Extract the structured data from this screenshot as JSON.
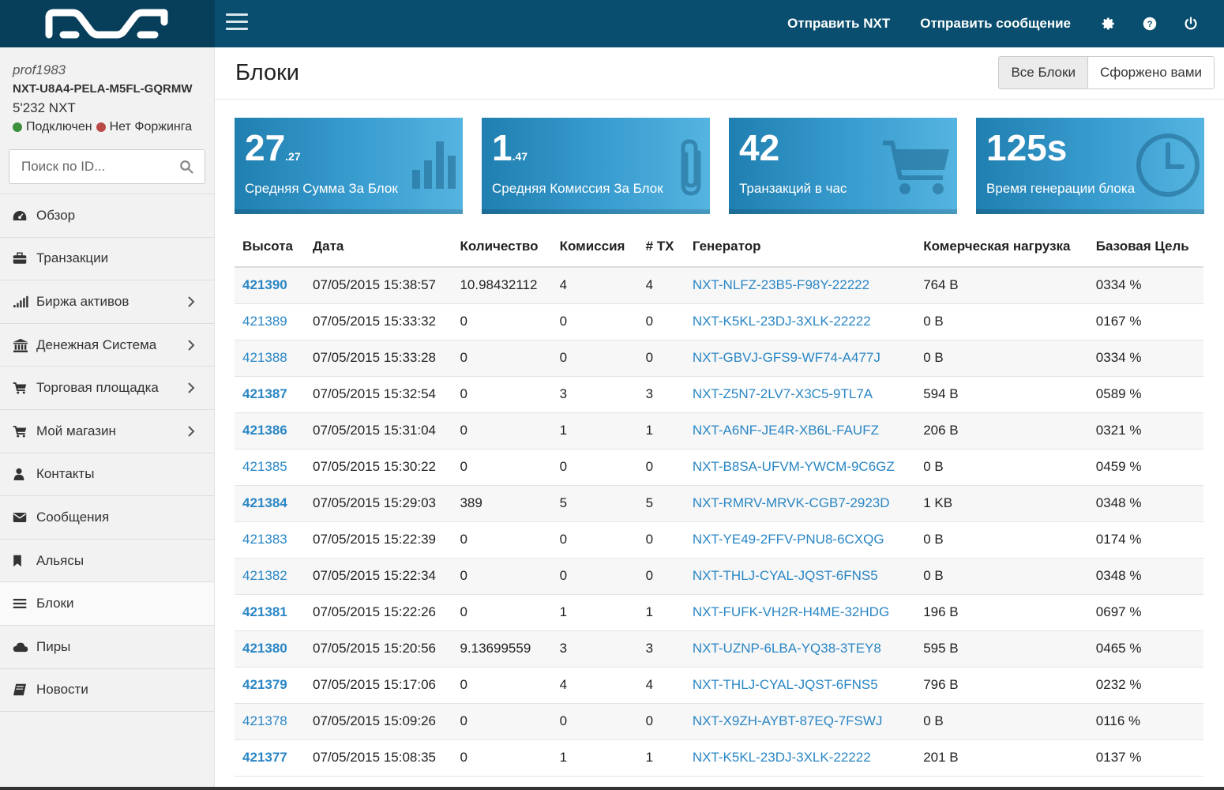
{
  "topbar": {
    "send_nxt": "Отправить NXT",
    "send_message": "Отправить сообщение",
    "icons": [
      "gear-icon",
      "question-icon",
      "power-icon"
    ]
  },
  "account": {
    "username": "prof1983",
    "account_id": "NXT-U8A4-PELA-M5FL-GQRMW",
    "balance": "5'232 NXT",
    "connected": "Подключен",
    "forging": "Нет Форжинга"
  },
  "search": {
    "placeholder": "Поиск по ID..."
  },
  "menu": [
    {
      "label": "Обзор",
      "icon": "dashboard-icon",
      "has_submenu": false
    },
    {
      "label": "Транзакции",
      "icon": "briefcase-icon",
      "has_submenu": false
    },
    {
      "label": "Биржа активов",
      "icon": "signal-icon",
      "has_submenu": true
    },
    {
      "label": "Денежная Система",
      "icon": "bank-icon",
      "has_submenu": true
    },
    {
      "label": "Торговая площадка",
      "icon": "cart-icon",
      "has_submenu": true
    },
    {
      "label": "Мой магазин",
      "icon": "cart-icon",
      "has_submenu": true
    },
    {
      "label": "Контакты",
      "icon": "user-icon",
      "has_submenu": false
    },
    {
      "label": "Сообщения",
      "icon": "envelope-icon",
      "has_submenu": false
    },
    {
      "label": "Альясы",
      "icon": "bookmark-icon",
      "has_submenu": false
    },
    {
      "label": "Блоки",
      "icon": "list-icon",
      "has_submenu": false,
      "active": true
    },
    {
      "label": "Пиры",
      "icon": "cloud-icon",
      "has_submenu": false
    },
    {
      "label": "Новости",
      "icon": "book-icon",
      "has_submenu": false
    }
  ],
  "page": {
    "title": "Блоки",
    "filter_all": "Все Блоки",
    "filter_forged": "Сфорженo вами"
  },
  "stats": [
    {
      "big": "27",
      "small": ".27",
      "label": "Средняя Сумма За Блок",
      "icon": "bar-chart-icon"
    },
    {
      "big": "1",
      "small": ".47",
      "label": "Средняя Комиссия За Блок",
      "icon": "paperclip-icon"
    },
    {
      "big": "42",
      "small": "",
      "label": "Транзакций в час",
      "icon": "cart-icon"
    },
    {
      "big": "125s",
      "small": "",
      "label": "Время генерации блока",
      "icon": "clock-icon"
    }
  ],
  "table": {
    "headers": [
      "Высота",
      "Дата",
      "Количество",
      "Комиссия",
      "# TX",
      "Генератор",
      "Комерческая нагрузка",
      "Базовая Цель"
    ],
    "rows": [
      {
        "height": "421390",
        "bold": true,
        "date": "07/05/2015 15:38:57",
        "amount": "10.98432112",
        "fee": "4",
        "tx": "4",
        "generator": "NXT-NLFZ-23B5-F98Y-22222",
        "payload": "764 B",
        "target": "0334 %"
      },
      {
        "height": "421389",
        "bold": false,
        "date": "07/05/2015 15:33:32",
        "amount": "0",
        "fee": "0",
        "tx": "0",
        "generator": "NXT-K5KL-23DJ-3XLK-22222",
        "payload": "0 B",
        "target": "0167 %"
      },
      {
        "height": "421388",
        "bold": false,
        "date": "07/05/2015 15:33:28",
        "amount": "0",
        "fee": "0",
        "tx": "0",
        "generator": "NXT-GBVJ-GFS9-WF74-A477J",
        "payload": "0 B",
        "target": "0334 %"
      },
      {
        "height": "421387",
        "bold": true,
        "date": "07/05/2015 15:32:54",
        "amount": "0",
        "fee": "3",
        "tx": "3",
        "generator": "NXT-Z5N7-2LV7-X3C5-9TL7A",
        "payload": "594 B",
        "target": "0589 %"
      },
      {
        "height": "421386",
        "bold": true,
        "date": "07/05/2015 15:31:04",
        "amount": "0",
        "fee": "1",
        "tx": "1",
        "generator": "NXT-A6NF-JE4R-XB6L-FAUFZ",
        "payload": "206 B",
        "target": "0321 %"
      },
      {
        "height": "421385",
        "bold": false,
        "date": "07/05/2015 15:30:22",
        "amount": "0",
        "fee": "0",
        "tx": "0",
        "generator": "NXT-B8SA-UFVM-YWCM-9C6GZ",
        "payload": "0 B",
        "target": "0459 %"
      },
      {
        "height": "421384",
        "bold": true,
        "date": "07/05/2015 15:29:03",
        "amount": "389",
        "fee": "5",
        "tx": "5",
        "generator": "NXT-RMRV-MRVK-CGB7-2923D",
        "payload": "1 KB",
        "target": "0348 %"
      },
      {
        "height": "421383",
        "bold": false,
        "date": "07/05/2015 15:22:39",
        "amount": "0",
        "fee": "0",
        "tx": "0",
        "generator": "NXT-YE49-2FFV-PNU8-6CXQG",
        "payload": "0 B",
        "target": "0174 %"
      },
      {
        "height": "421382",
        "bold": false,
        "date": "07/05/2015 15:22:34",
        "amount": "0",
        "fee": "0",
        "tx": "0",
        "generator": "NXT-THLJ-CYAL-JQST-6FNS5",
        "payload": "0 B",
        "target": "0348 %"
      },
      {
        "height": "421381",
        "bold": true,
        "date": "07/05/2015 15:22:26",
        "amount": "0",
        "fee": "1",
        "tx": "1",
        "generator": "NXT-FUFK-VH2R-H4ME-32HDG",
        "payload": "196 B",
        "target": "0697 %"
      },
      {
        "height": "421380",
        "bold": true,
        "date": "07/05/2015 15:20:56",
        "amount": "9.13699559",
        "fee": "3",
        "tx": "3",
        "generator": "NXT-UZNP-6LBA-YQ38-3TEY8",
        "payload": "595 B",
        "target": "0465 %"
      },
      {
        "height": "421379",
        "bold": true,
        "date": "07/05/2015 15:17:06",
        "amount": "0",
        "fee": "4",
        "tx": "4",
        "generator": "NXT-THLJ-CYAL-JQST-6FNS5",
        "payload": "796 B",
        "target": "0232 %"
      },
      {
        "height": "421378",
        "bold": false,
        "date": "07/05/2015 15:09:26",
        "amount": "0",
        "fee": "0",
        "tx": "0",
        "generator": "NXT-X9ZH-AYBT-87EQ-7FSWJ",
        "payload": "0 B",
        "target": "0116 %"
      },
      {
        "height": "421377",
        "bold": true,
        "date": "07/05/2015 15:08:35",
        "amount": "0",
        "fee": "1",
        "tx": "1",
        "generator": "NXT-K5KL-23DJ-3XLK-22222",
        "payload": "201 B",
        "target": "0137 %"
      }
    ]
  }
}
